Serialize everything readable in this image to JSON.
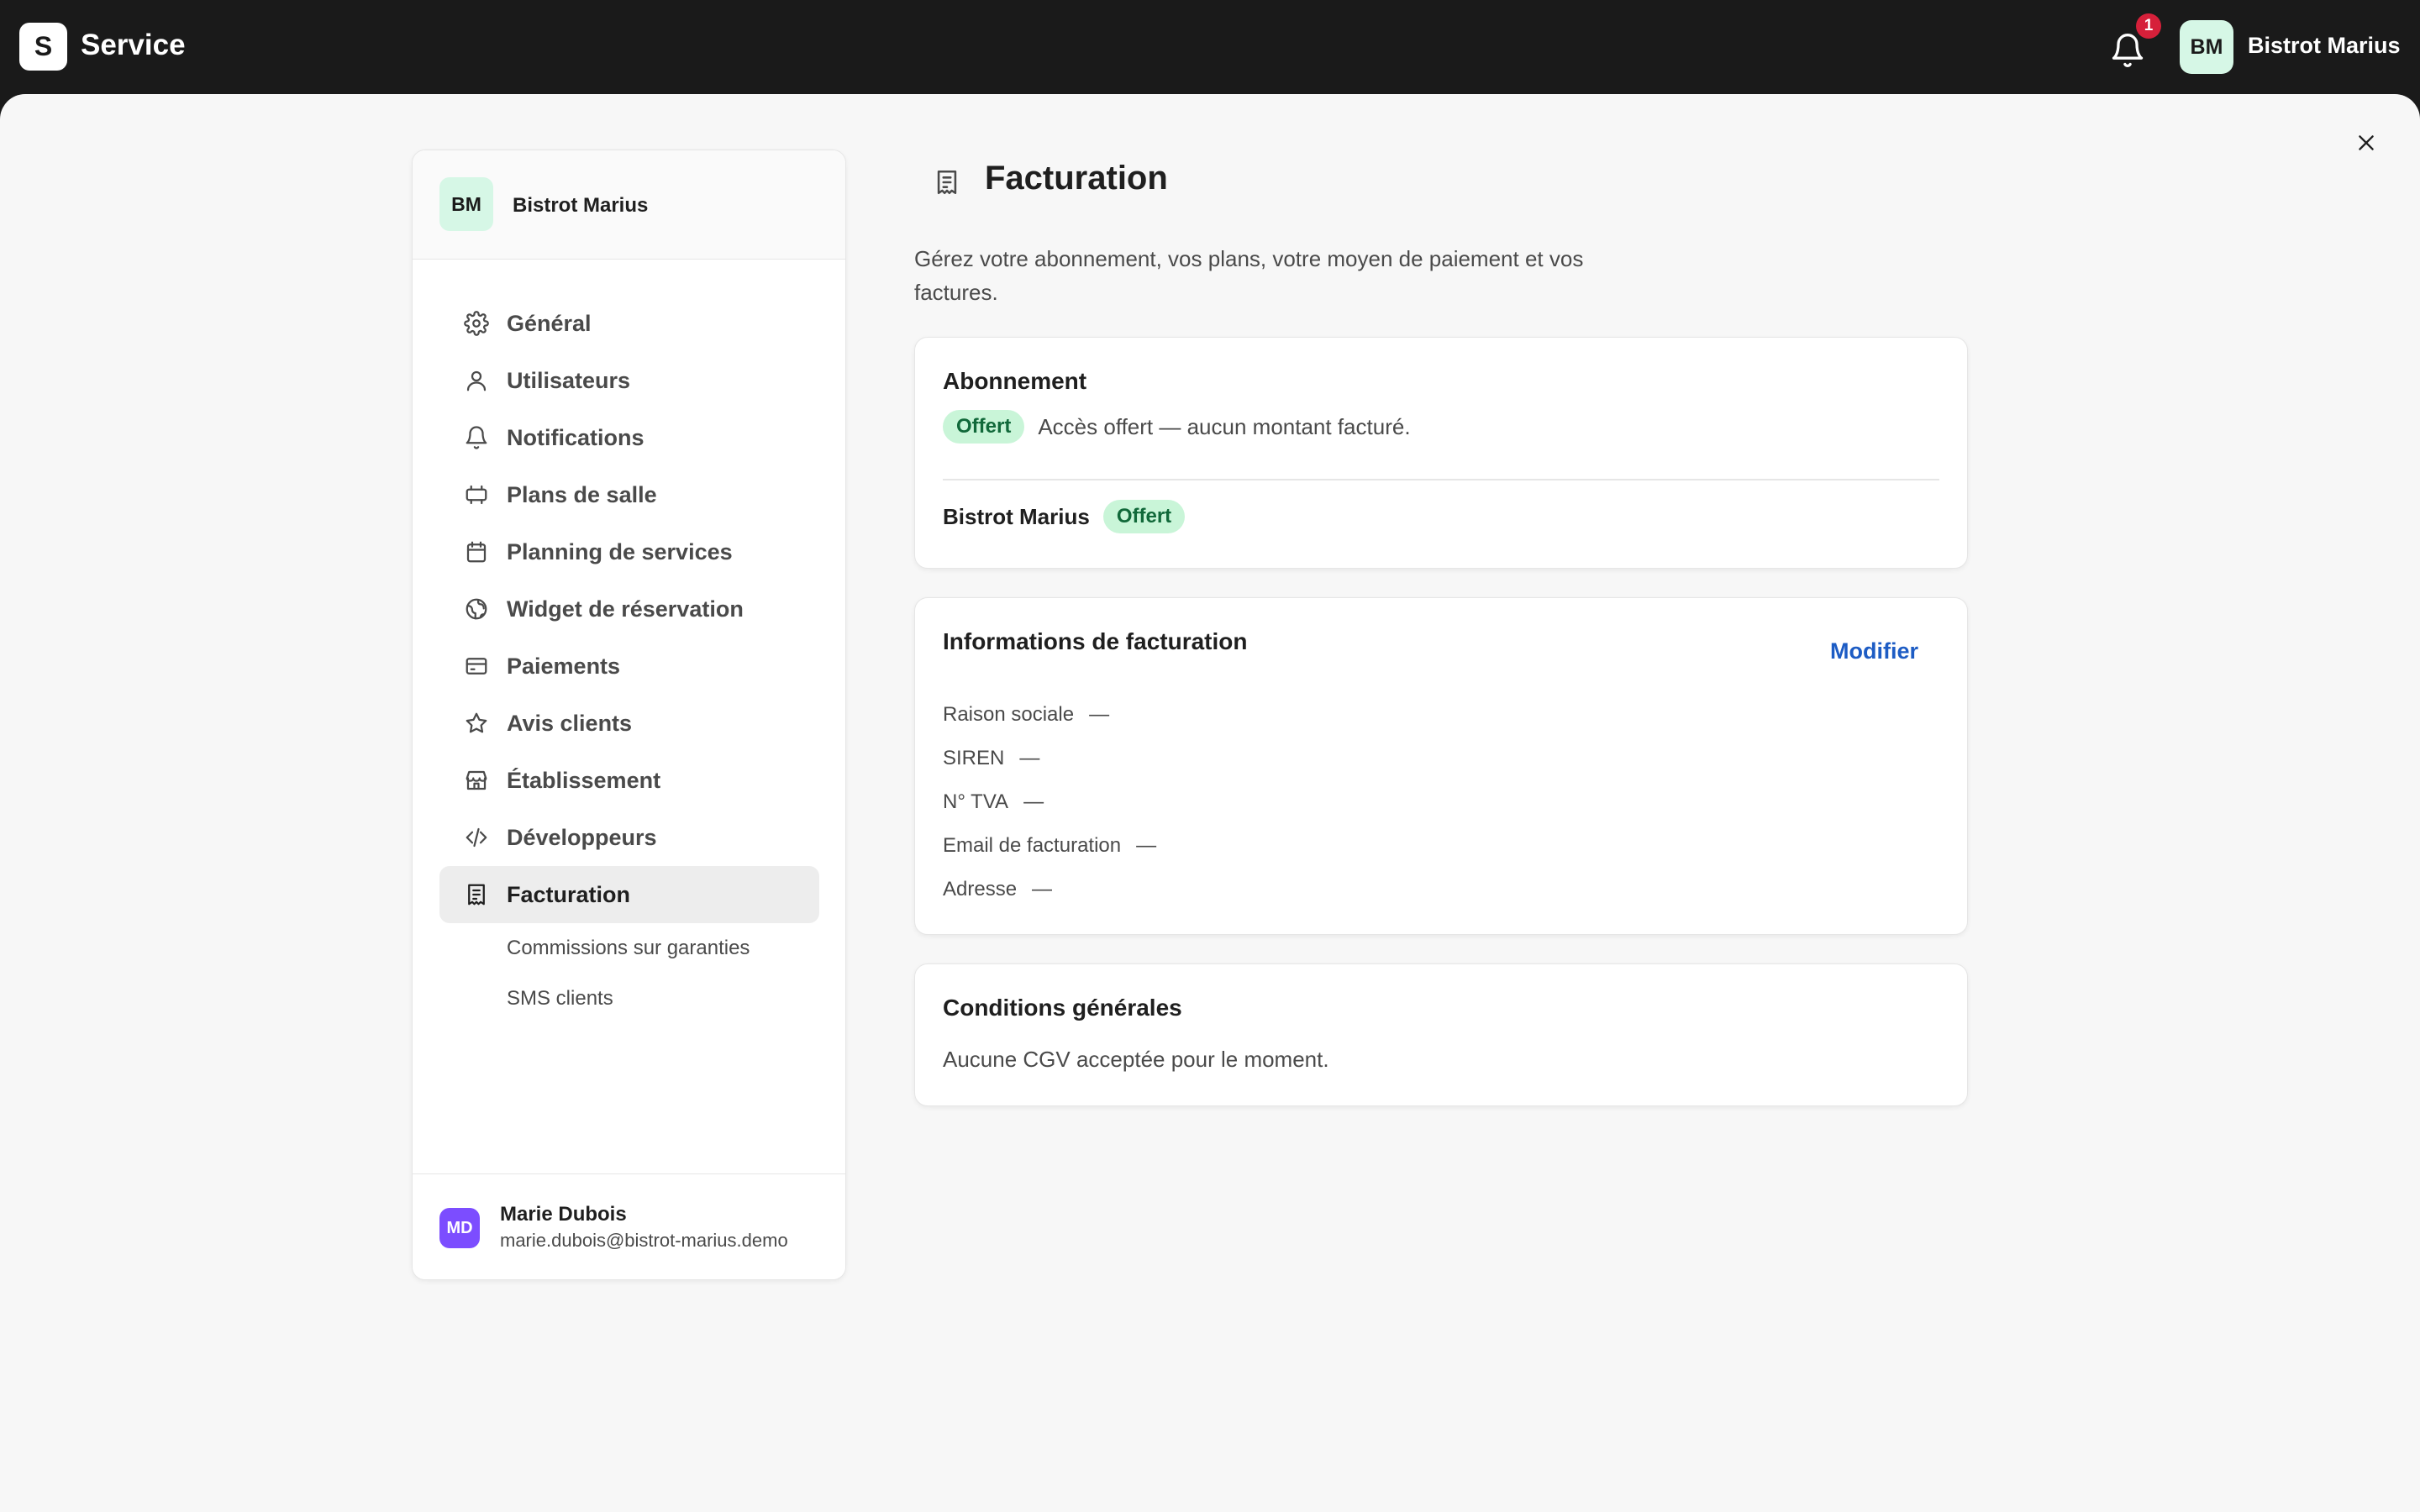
{
  "app": {
    "logo_letter": "S",
    "name": "Service",
    "notification_count": "1",
    "user_initials": "BM",
    "user_name": "Bistrot Marius"
  },
  "sidebar": {
    "org_initials": "BM",
    "org_name": "Bistrot Marius",
    "items": [
      {
        "label": "Général",
        "icon": "gear-icon"
      },
      {
        "label": "Utilisateurs",
        "icon": "user-icon"
      },
      {
        "label": "Notifications",
        "icon": "bell-icon"
      },
      {
        "label": "Plans de salle",
        "icon": "table-icon"
      },
      {
        "label": "Planning de services",
        "icon": "calendar-icon"
      },
      {
        "label": "Widget de réservation",
        "icon": "globe-icon"
      },
      {
        "label": "Paiements",
        "icon": "credit-card-icon"
      },
      {
        "label": "Avis clients",
        "icon": "star-icon"
      },
      {
        "label": "Établissement",
        "icon": "store-icon"
      },
      {
        "label": "Développeurs",
        "icon": "code-icon"
      },
      {
        "label": "Facturation",
        "icon": "receipt-icon",
        "active": true
      }
    ],
    "sub_items": [
      {
        "label": "Commissions sur garanties"
      },
      {
        "label": "SMS clients"
      }
    ],
    "footer": {
      "initials": "MD",
      "name": "Marie Dubois",
      "email": "marie.dubois@bistrot-marius.demo"
    }
  },
  "main": {
    "title": "Facturation",
    "description": "Gérez votre abonnement, vos plans, votre moyen de paiement et vos factures.",
    "subscription": {
      "title": "Abonnement",
      "badge": "Offert",
      "text": "Accès offert — aucun montant facturé.",
      "venue_name": "Bistrot Marius",
      "venue_badge": "Offert"
    },
    "billing_info": {
      "title": "Informations de facturation",
      "edit_label": "Modifier",
      "rows": [
        {
          "label": "Raison sociale",
          "value": "—"
        },
        {
          "label": "SIREN",
          "value": "—"
        },
        {
          "label": "N° TVA",
          "value": "—"
        },
        {
          "label": "Email de facturation",
          "value": "—"
        },
        {
          "label": "Adresse",
          "value": "—"
        }
      ]
    },
    "terms": {
      "title": "Conditions générales",
      "text": "Aucune CGV acceptée pour le moment."
    }
  },
  "colors": {
    "topbar": "#1a1a1a",
    "badge_bg": "#c9f5d8",
    "badge_text": "#11693a",
    "link": "#1d5cc4",
    "notification": "#d6203a",
    "footer_avatar": "#7c4dff"
  }
}
